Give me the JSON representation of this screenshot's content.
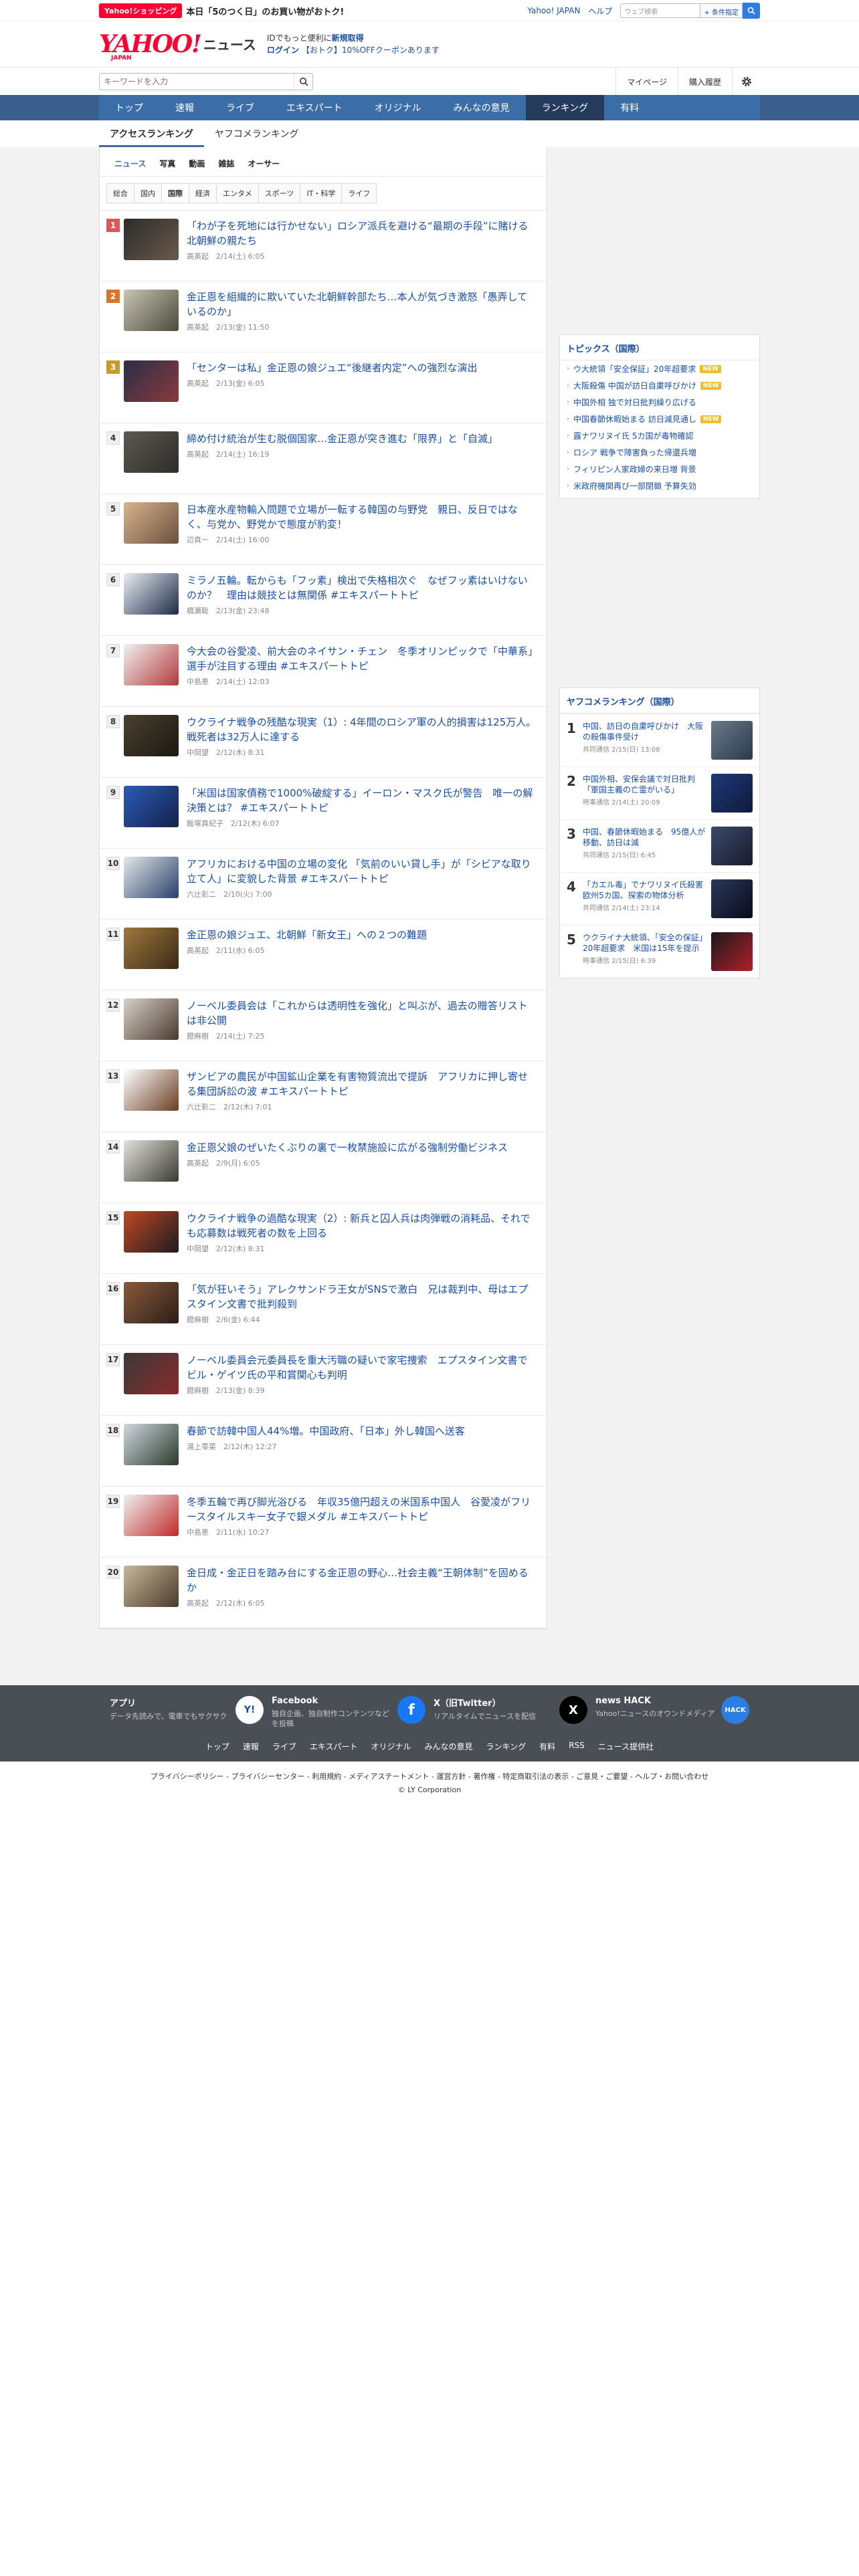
{
  "topbar": {
    "promo_badge": "Yahoo!ショッピング",
    "promo_text": "本日「5のつく日」のお買い物がおトク!",
    "links": [
      "Yahoo! JAPAN",
      "ヘルプ"
    ],
    "web_search_placeholder": "ウェブ検索",
    "web_search_detail": "+ 条件指定"
  },
  "masthead": {
    "logo": "YAHOO!",
    "logo_japan": "JAPAN",
    "logo_sub": "ニュース",
    "login_line1_pre": "IDでもっと便利に",
    "login_line1_link": "新規取得",
    "login_link": "ログイン",
    "coupon": "【おトク】10%OFFクーポンあります"
  },
  "search": {
    "placeholder": "キーワードを入力",
    "mypage": "マイページ",
    "history": "購入履歴"
  },
  "nav": {
    "items": [
      "トップ",
      "速報",
      "ライブ",
      "エキスパート",
      "オリジナル",
      "みんなの意見",
      "ランキング",
      "有料"
    ],
    "active": "ランキング"
  },
  "subnav": {
    "tabs": [
      "アクセスランキング",
      "ヤフコメランキング"
    ]
  },
  "categories1": [
    "ニュース",
    "写真",
    "動画",
    "雑誌",
    "オーサー"
  ],
  "categories2": [
    "総合",
    "国内",
    "国際",
    "経済",
    "エンタメ",
    "スポーツ",
    "IT・科学",
    "ライフ"
  ],
  "ranking": [
    {
      "num": "1",
      "title": "「わが子を死地には行かせない」ロシア派兵を避ける“最期の手段”に賭ける北朝鮮の親たち",
      "meta": "高英起　2/14(土) 6:05"
    },
    {
      "num": "2",
      "title": "金正恩を組織的に欺いていた北朝鮮幹部たち…本人が気づき激怒「愚弄しているのか」",
      "meta": "高英起　2/13(金) 11:50"
    },
    {
      "num": "3",
      "title": "「センターは私」金正恩の娘ジュエ“後継者内定”への強烈な演出",
      "meta": "高英起　2/13(金) 6:05"
    },
    {
      "num": "4",
      "title": "締め付け統治が生む脱個国家…金正恩が突き進む「限界」と「自滅」",
      "meta": "高英起　2/14(土) 16:19"
    },
    {
      "num": "5",
      "title": "日本産水産物輸入問題で立場が一転する韓国の与野党　親日、反日ではなく、与党か、野党かで態度が豹変！",
      "meta": "辺真一　2/14(土) 16:00"
    },
    {
      "num": "6",
      "title": "ミラノ五輪。転からも「フッ素」検出で失格相次ぐ　なぜフッ素はいけないのか？　理由は競技とは無関係 #エキスパートトピ",
      "meta": "橋瀬聡　2/13(金) 23:48"
    },
    {
      "num": "7",
      "title": "今大会の谷愛凌、前大会のネイサン・チェン　冬季オリンピックで「中華系」選手が注目する理由 #エキスパートトピ",
      "meta": "中島恵　2/14(土) 12:03"
    },
    {
      "num": "8",
      "title": "ウクライナ戦争の残酷な現実（1）: 4年間のロシア軍の人的損害は125万人。戦死者は32万人に達する",
      "meta": "中岡望　2/12(木) 8:31"
    },
    {
      "num": "9",
      "title": "「米国は国家債務で1000%破綻する」イーロン・マスク氏が警告　唯一の解決策とは？ #エキスパートトピ",
      "meta": "飯塚真紀子　2/12(木) 6:07"
    },
    {
      "num": "10",
      "title": "アフリカにおける中国の立場の変化 「気前のいい貸し手」が「シビアな取り立て人」に変貌した背景 #エキスパートトピ",
      "meta": "六辻彰二　2/10(火) 7:00"
    },
    {
      "num": "11",
      "title": "金正恩の娘ジュエ、北朝鮮「新女王」への２つの難題",
      "meta": "高英起　2/11(水) 6:05"
    },
    {
      "num": "12",
      "title": "ノーベル委員会は「これからは透明性を強化」と叫ぶが、過去の贈答リストは非公開",
      "meta": "鐙麻樹　2/14(土) 7:25"
    },
    {
      "num": "13",
      "title": "ザンビアの農民が中国鉱山企業を有害物質流出で提訴　アフリカに押し寄せる集団訴訟の波 #エキスパートトピ",
      "meta": "六辻彰二　2/12(木) 7:01"
    },
    {
      "num": "14",
      "title": "金正恩父娘のぜいたくぶりの裏で一枚禁施設に広がる強制労働ビジネス",
      "meta": "高英起　2/9(月) 6:05"
    },
    {
      "num": "15",
      "title": "ウクライナ戦争の過酷な現実（2）: 新兵と囚人兵は肉弾戦の消耗品、それでも応募数は戦死者の数を上回る",
      "meta": "中岡望　2/12(木) 8:31"
    },
    {
      "num": "16",
      "title": "「気が狂いそう」アレクサンドラ王女がSNSで激白　兄は裁判中、母はエプスタイン文書で批判殺到",
      "meta": "鐙麻樹　2/6(金) 6:44"
    },
    {
      "num": "17",
      "title": "ノーベル委員会元委員長を重大汚職の疑いで家宅捜索　エプスタイン文書でビル・ゲイツ氏の平和賞関心も判明",
      "meta": "鐙麻樹　2/13(金) 8:39"
    },
    {
      "num": "18",
      "title": "春節で訪韓中国人44%増。中国政府、「日本」外し韓国へ送客",
      "meta": "湯上零菜　2/12(木) 12:27"
    },
    {
      "num": "19",
      "title": "冬季五輪で再び脚光浴びる　年収35億円超えの米国系中国人　谷愛凌がフリースタイルスキー女子で銀メダル #エキスパートトピ",
      "meta": "中島恵　2/11(水) 10:27"
    },
    {
      "num": "20",
      "title": "金日成・金正日を踏み台にする金正恩の野心…社会主義“王朝体制”を固めるか",
      "meta": "高英起　2/12(木) 6:05"
    }
  ],
  "topics": {
    "head": "トピックス（国際）",
    "new_label": "NEW",
    "items": [
      {
        "text": "ウ大統領「安全保証」20年超要求",
        "new": true
      },
      {
        "text": "大阪殺傷 中国が訪日自粛呼びかけ",
        "new": true
      },
      {
        "text": "中国外相 独で対日批判繰り広げる",
        "new": false
      },
      {
        "text": "中国春節休暇始まる 訪日減見通し",
        "new": true
      },
      {
        "text": "露ナワリヌイ氏 5カ国が毒物確認",
        "new": false
      },
      {
        "text": "ロシア 戦争で障害負った帰還兵増",
        "new": false
      },
      {
        "text": "フィリピン人家政婦の来日増 背景",
        "new": false
      },
      {
        "text": "米政府機関再び一部閉鎖 予算失効",
        "new": false
      }
    ]
  },
  "yafuko": {
    "head": "ヤフコメランキング（国際）",
    "items": [
      {
        "num": "1",
        "title": "中国、訪日の自粛呼びかけ　大阪の殺傷事件受け",
        "meta": "共同通信 2/15(日) 13:08"
      },
      {
        "num": "2",
        "title": "中国外相、安保会議で対日批判「軍国主義の亡霊がいる」",
        "meta": "時事通信 2/14(土) 20:09"
      },
      {
        "num": "3",
        "title": "中国、春節休暇始まる　95億人が移動、訪日は減",
        "meta": "共同通信 2/15(日) 6:45"
      },
      {
        "num": "4",
        "title": "「カエル毒」でナワリヌイ氏殺害 欧州5カ国、探索の物体分析",
        "meta": "共同通信 2/14(土) 23:14"
      },
      {
        "num": "5",
        "title": "ウクライナ大統領、「安全の保証」20年超要求　米国は15年を提示",
        "meta": "時事通信 2/15(日) 6:39"
      }
    ]
  },
  "footer": {
    "apps": [
      {
        "title": "アプリ",
        "desc": "データ先読みで、電車でもサクサク",
        "icon": "Y!"
      },
      {
        "title": "Facebook",
        "desc": "独自企画、独自制作コンテンツなどを投稿",
        "icon": "f"
      },
      {
        "title": "X（旧Twitter）",
        "desc": "リアルタイムでニュースを配信",
        "icon": "X"
      },
      {
        "title": "news HACK",
        "desc": "Yahoo!ニュースのオウンドメディア",
        "icon": "HACK"
      }
    ],
    "links": [
      "トップ",
      "速報",
      "ライブ",
      "エキスパート",
      "オリジナル",
      "みんなの意見",
      "ランキング",
      "有料",
      "RSS",
      "ニュース提供社"
    ],
    "legal": "プライバシーポリシー - プライバシーセンター - 利用規約 - メディアステートメント - 運営方針 - 著作権 - 特定商取引法の表示 - ご意見・ご要望 - ヘルプ・お問い合わせ",
    "copyright": "© LY Corporation"
  }
}
